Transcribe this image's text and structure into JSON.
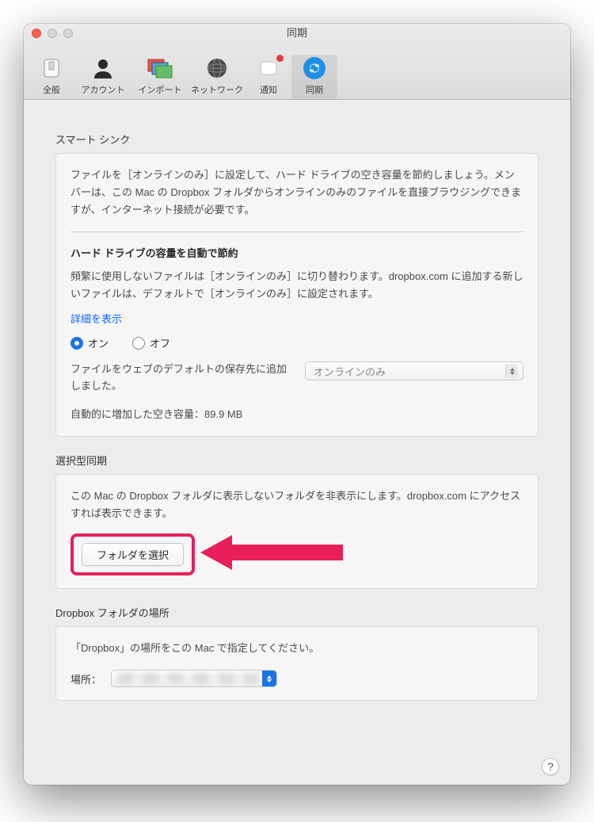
{
  "window": {
    "title": "同期"
  },
  "toolbar": {
    "items": [
      {
        "label": "全般"
      },
      {
        "label": "アカウント"
      },
      {
        "label": "インポート"
      },
      {
        "label": "ネットワーク"
      },
      {
        "label": "通知",
        "badge": true
      },
      {
        "label": "同期",
        "selected": true
      }
    ]
  },
  "smartSync": {
    "heading": "スマート シンク",
    "intro": "ファイルを［オンラインのみ］に設定して、ハード ドライブの空き容量を節約しましょう。メンバーは、この Mac の Dropbox フォルダからオンラインのみのファイルを直接ブラウジングできますが、インターネット接続が必要です。",
    "autoHeading": "ハード ドライブの容量を自動で節約",
    "autoDesc": "頻繁に使用しないファイルは［オンラインのみ］に切り替わります。dropbox.com に追加する新しいファイルは、デフォルトで［オンラインのみ］に設定されます。",
    "detailsLink": "詳細を表示",
    "radioOn": "オン",
    "radioOff": "オフ",
    "defaultSaveLabel": "ファイルをウェブのデフォルトの保存先に追加しました。",
    "defaultSaveValue": "オンラインのみ",
    "freedLabel": "自動的に増加した空き容量：",
    "freedValue": "89.9 MB"
  },
  "selectiveSync": {
    "heading": "選択型同期",
    "desc": "この Mac の Dropbox フォルダに表示しないフォルダを非表示にします。dropbox.com にアクセスすれば表示できます。",
    "button": "フォルダを選択"
  },
  "location": {
    "heading": "Dropbox フォルダの場所",
    "desc": "「Dropbox」の場所をこの Mac で指定してください。",
    "label": "場所："
  },
  "help": "?"
}
